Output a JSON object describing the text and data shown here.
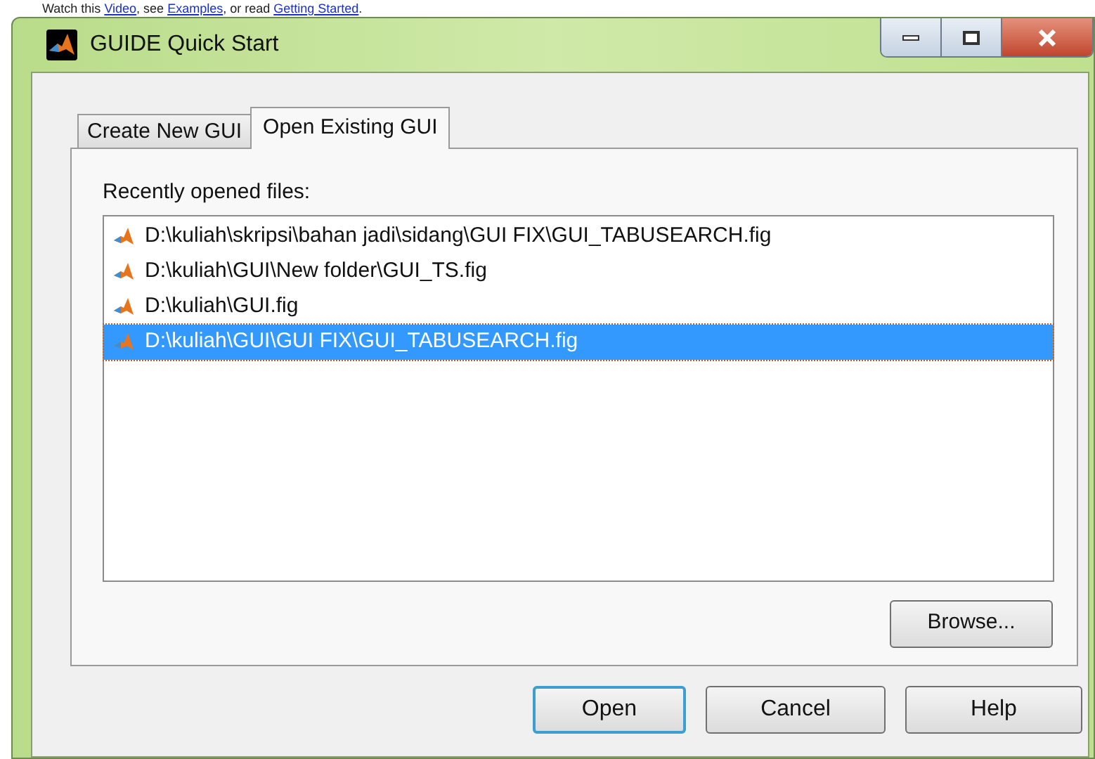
{
  "background_hint": [
    {
      "kind": "text",
      "text": "Watch this "
    },
    {
      "kind": "link",
      "text": "Video"
    },
    {
      "kind": "text",
      "text": ", see "
    },
    {
      "kind": "link",
      "text": "Examples"
    },
    {
      "kind": "text",
      "text": ", or read "
    },
    {
      "kind": "link",
      "text": "Getting Started"
    },
    {
      "kind": "text",
      "text": "."
    }
  ],
  "window": {
    "title": "GUIDE Quick Start"
  },
  "tabs": [
    {
      "label": "Create New GUI",
      "selected": false
    },
    {
      "label": "Open Existing GUI",
      "selected": true
    }
  ],
  "recent_files": {
    "label": "Recently opened files:",
    "items": [
      {
        "path": "D:\\kuliah\\skripsi\\bahan jadi\\sidang\\GUI FIX\\GUI_TABUSEARCH.fig",
        "selected": false
      },
      {
        "path": "D:\\kuliah\\GUI\\New folder\\GUI_TS.fig",
        "selected": false
      },
      {
        "path": "D:\\kuliah\\GUI.fig",
        "selected": false
      },
      {
        "path": "D:\\kuliah\\GUI\\GUI FIX\\GUI_TABUSEARCH.fig",
        "selected": true
      }
    ]
  },
  "browse_button": "Browse...",
  "buttons": [
    {
      "label": "Open",
      "kind": "default"
    },
    {
      "label": "Cancel",
      "kind": "normal"
    },
    {
      "label": "Help",
      "kind": "normal"
    }
  ]
}
